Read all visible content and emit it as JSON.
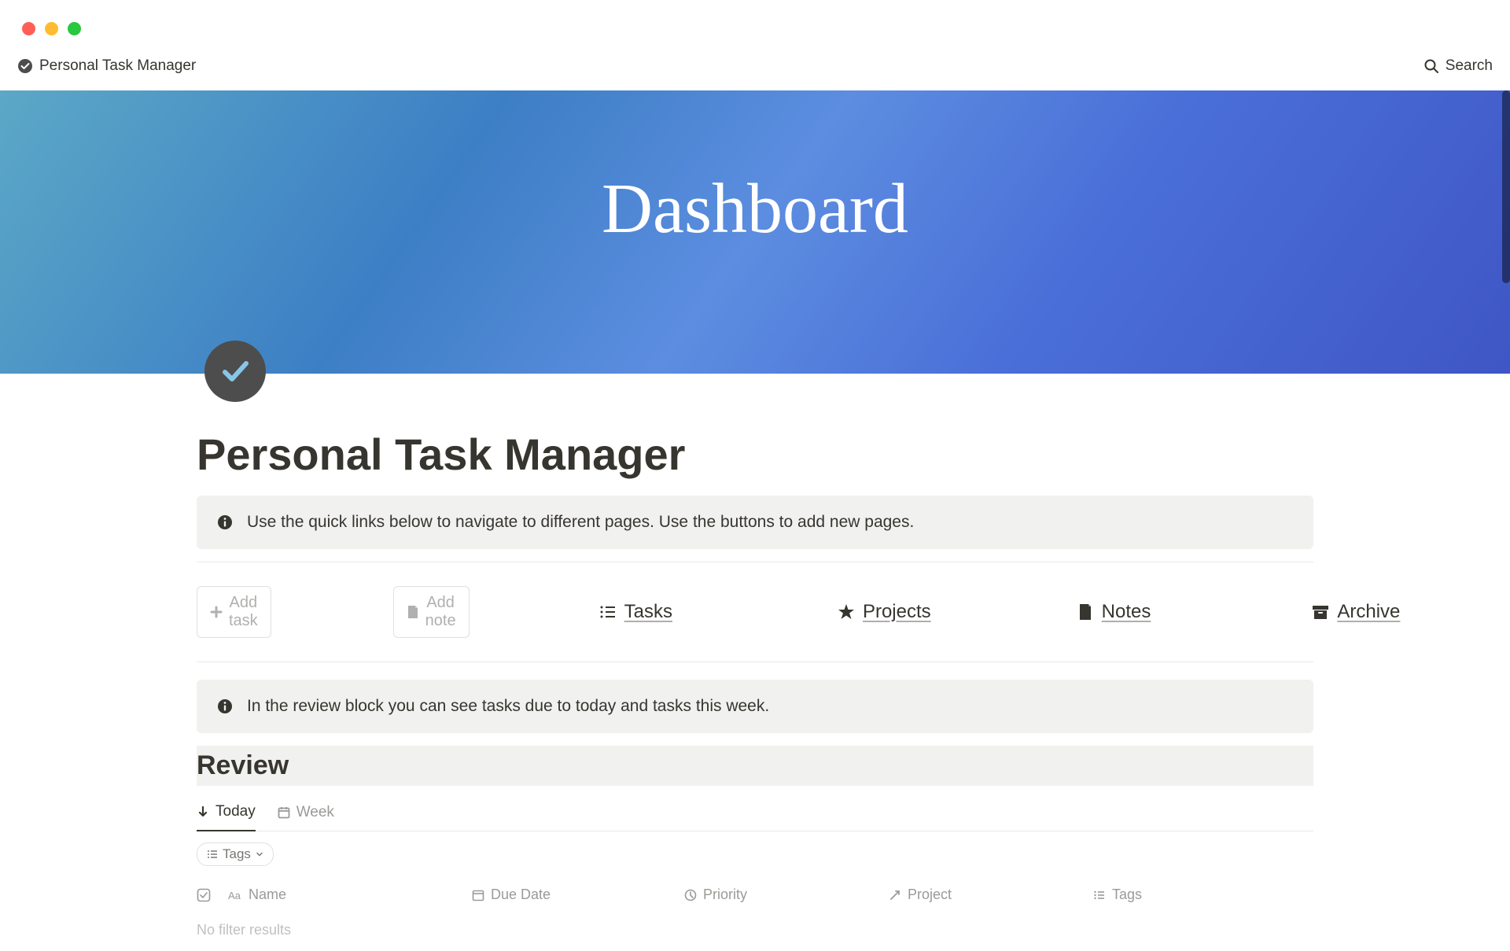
{
  "breadcrumb": {
    "title": "Personal Task Manager"
  },
  "header": {
    "search_label": "Search"
  },
  "cover": {
    "title": "Dashboard"
  },
  "page": {
    "title": "Personal Task Manager"
  },
  "callouts": {
    "navigation": "Use the quick links below to navigate to different pages. Use the buttons to add new pages.",
    "review": "In the review block you can see tasks due to today and tasks this week."
  },
  "buttons": {
    "add_task": "Add task",
    "add_note": "Add note"
  },
  "links": {
    "tasks": "Tasks",
    "projects": "Projects",
    "notes": "Notes",
    "archive": "Archive"
  },
  "review": {
    "title": "Review",
    "tabs": {
      "today": "Today",
      "week": "Week"
    },
    "filter": {
      "tags": "Tags"
    },
    "columns": {
      "name": "Name",
      "due_date": "Due Date",
      "priority": "Priority",
      "project": "Project",
      "tags": "Tags"
    },
    "empty": "No filter results"
  }
}
